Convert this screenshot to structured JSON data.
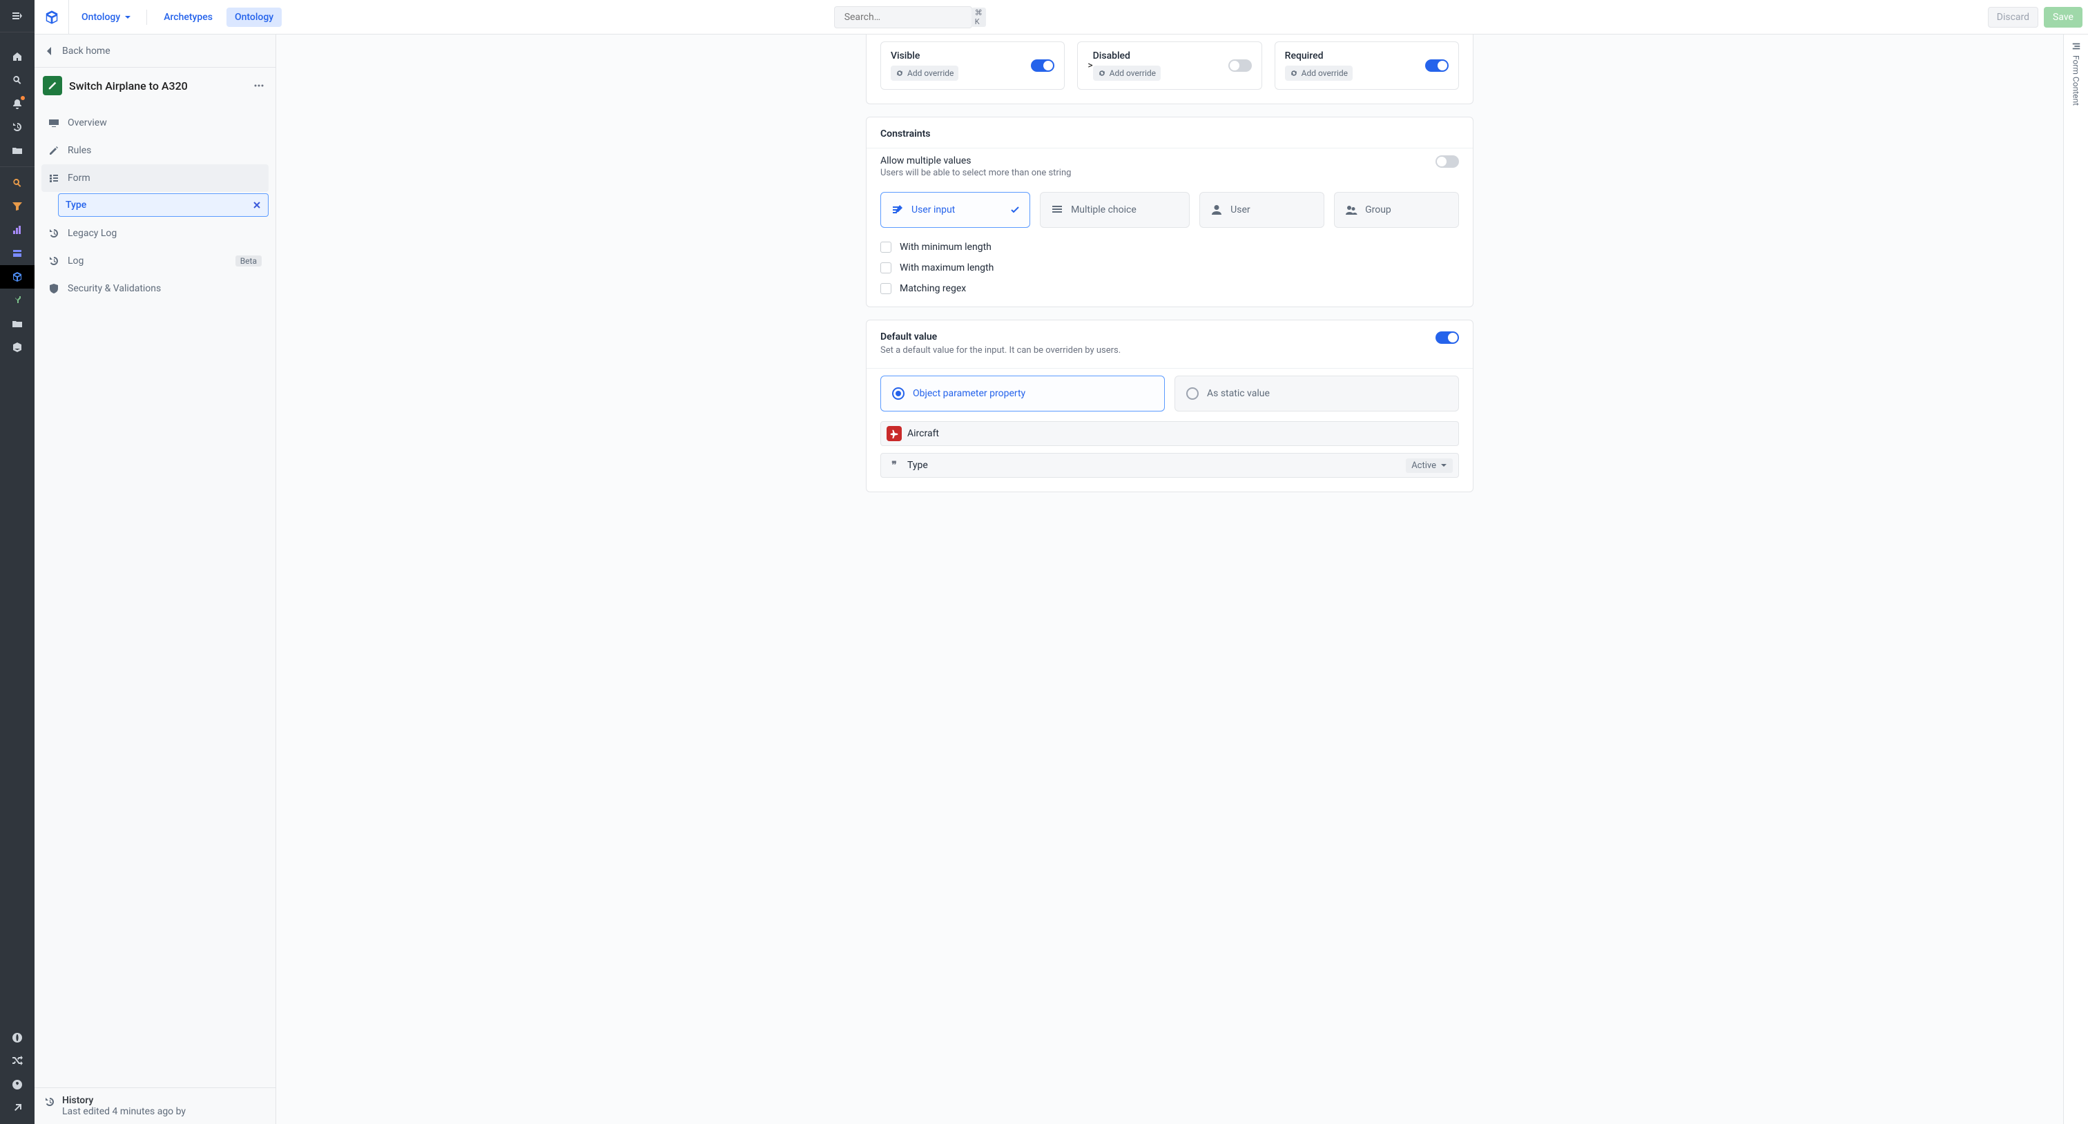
{
  "header": {
    "brand_dropdown": "Ontology",
    "tabs": {
      "archetypes": "Archetypes",
      "ontology": "Ontology"
    },
    "search_placeholder": "Search…",
    "search_kbd": "⌘ K",
    "discard": "Discard",
    "save": "Save"
  },
  "sidebar": {
    "back": "Back home",
    "title": "Switch Airplane to A320",
    "nav": {
      "overview": "Overview",
      "rules": "Rules",
      "form": "Form",
      "form_chip": "Type",
      "legacy_log": "Legacy Log",
      "log": "Log",
      "log_badge": "Beta",
      "security": "Security & Validations"
    },
    "history": {
      "title": "History",
      "subtitle": "Last edited 4 minutes ago by"
    }
  },
  "right_rail": {
    "label": "Form Content"
  },
  "behavior": {
    "visible": "Visible",
    "disabled": "Disabled",
    "required": "Required",
    "override": "Add override"
  },
  "constraints": {
    "heading": "Constraints",
    "allow_multiple_title": "Allow multiple values",
    "allow_multiple_sub": "Users will be able to select more than one string",
    "modes": {
      "user_input": "User input",
      "multiple_choice": "Multiple choice",
      "user": "User",
      "group": "Group"
    },
    "checks": {
      "min": "With minimum length",
      "max": "With maximum length",
      "regex": "Matching regex"
    }
  },
  "default_value": {
    "heading": "Default value",
    "sub": "Set a default value for the input. It can be overriden by users.",
    "opt_object": "Object parameter property",
    "opt_static": "As static value",
    "object_pill": "Aircraft",
    "prop_pill": "Type",
    "prop_dropdown": "Active"
  }
}
